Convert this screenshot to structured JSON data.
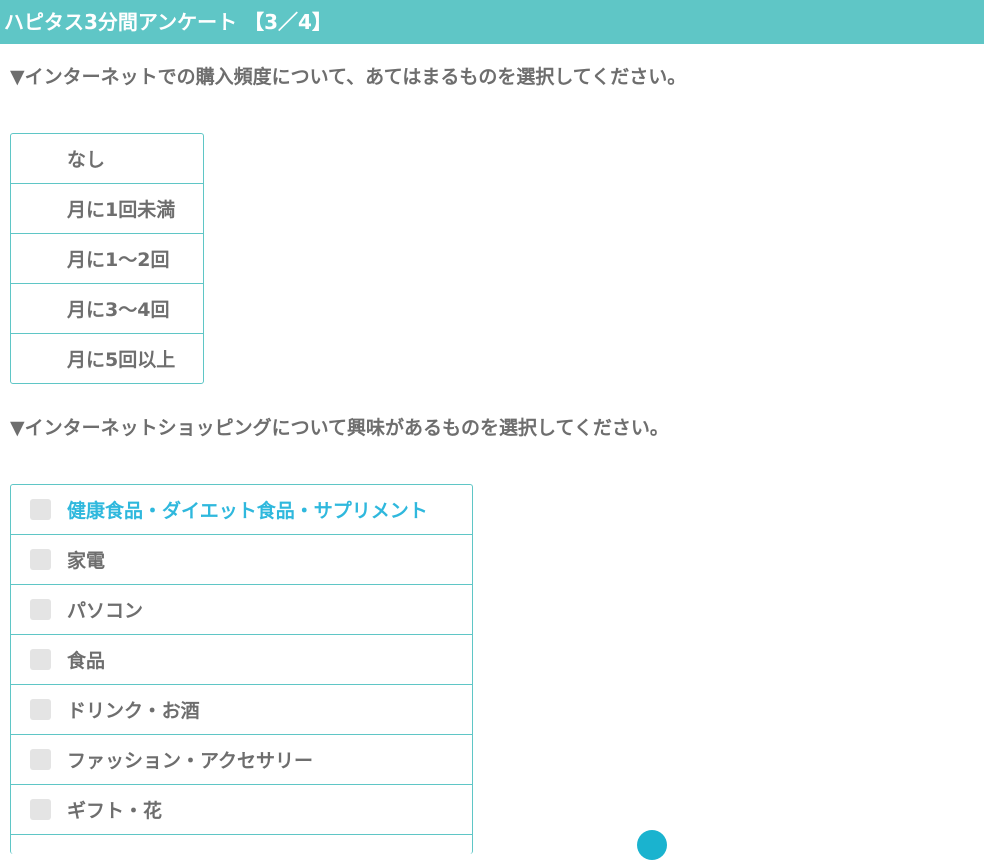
{
  "header": {
    "title": "ハピタス3分間アンケート 【3／4】"
  },
  "question1": {
    "text": "▼インターネットでの購入頻度について、あてはまるものを選択してください。",
    "options": [
      {
        "label": "なし"
      },
      {
        "label": "月に1回未満"
      },
      {
        "label": "月に1～2回"
      },
      {
        "label": "月に3～4回"
      },
      {
        "label": "月に5回以上"
      }
    ]
  },
  "question2": {
    "text": "▼インターネットショッピングについて興味があるものを選択してください。",
    "options": [
      {
        "label": "健康食品・ダイエット食品・サプリメント",
        "checked": false
      },
      {
        "label": "家電",
        "checked": false
      },
      {
        "label": "パソコン",
        "checked": false
      },
      {
        "label": "食品",
        "checked": false
      },
      {
        "label": "ドリンク・お酒",
        "checked": false
      },
      {
        "label": "ファッション・アクセサリー",
        "checked": false
      },
      {
        "label": "ギフト・花",
        "checked": false
      },
      {
        "label": ""
      }
    ]
  },
  "colors": {
    "header_bg": "#5fc6c6",
    "border": "#5fc6c6",
    "highlight_text": "#2fb8dd",
    "fab": "#1ab3cf"
  },
  "icons": {
    "fab": "scroll-button-icon"
  }
}
